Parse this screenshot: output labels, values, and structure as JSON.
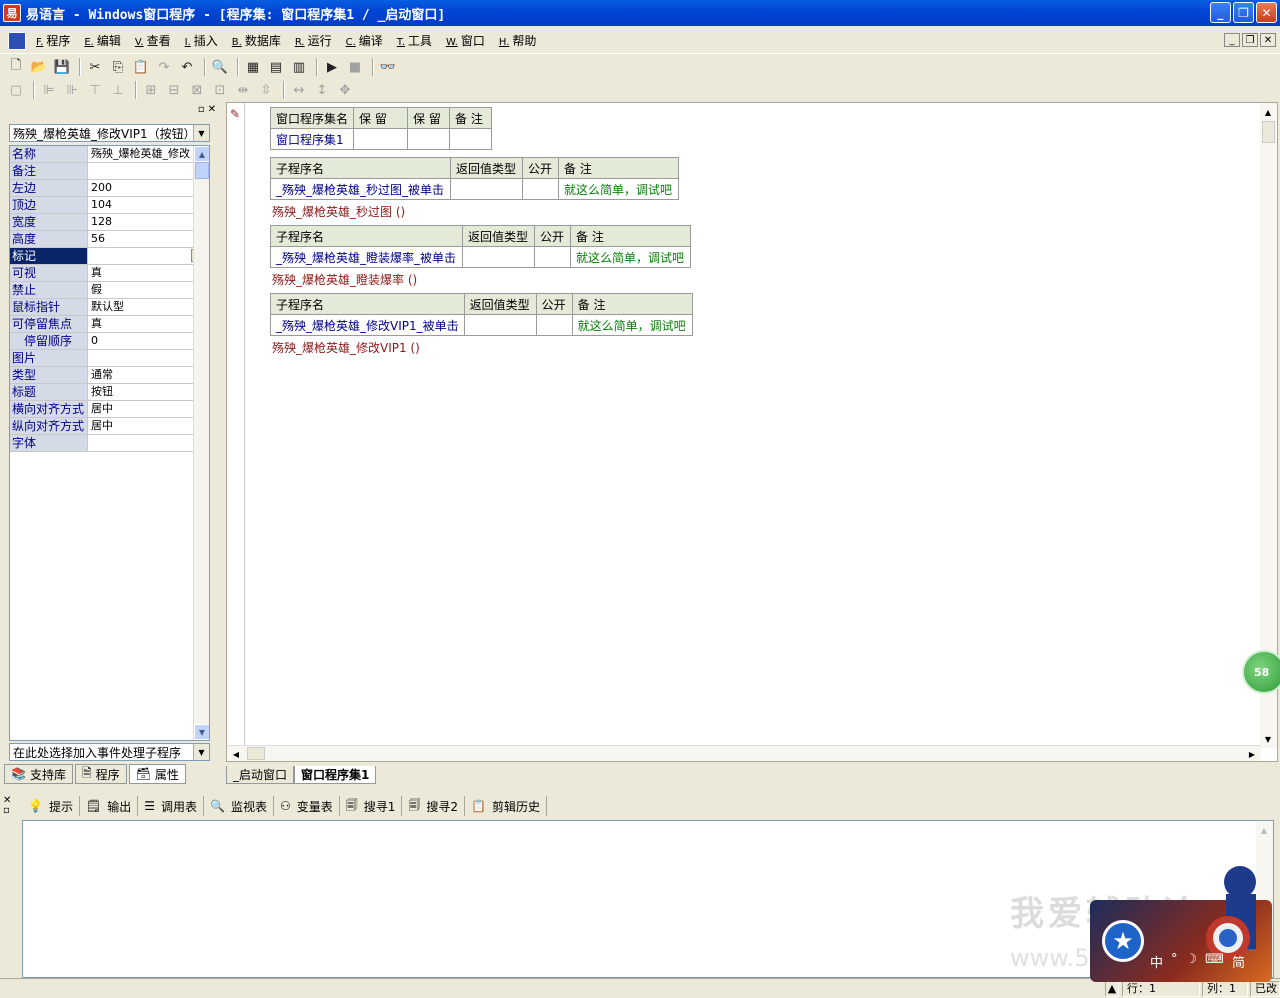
{
  "window": {
    "title": "易语言 - Windows窗口程序 - [程序集: 窗口程序集1 / _启动窗口]"
  },
  "menu": [
    {
      "acc": "F.",
      "label": "程序"
    },
    {
      "acc": "E.",
      "label": "编辑"
    },
    {
      "acc": "V.",
      "label": "查看"
    },
    {
      "acc": "I.",
      "label": "插入"
    },
    {
      "acc": "B.",
      "label": "数据库"
    },
    {
      "acc": "R.",
      "label": "运行"
    },
    {
      "acc": "C.",
      "label": "编译"
    },
    {
      "acc": "T.",
      "label": "工具"
    },
    {
      "acc": "W.",
      "label": "窗口"
    },
    {
      "acc": "H.",
      "label": "帮助"
    }
  ],
  "left_panel": {
    "object_combo": "殇殃_爆枪英雄_修改VIP1（按钮）",
    "properties": [
      {
        "name": "名称",
        "value": "殇殃_爆枪英雄_修改"
      },
      {
        "name": "备注",
        "value": ""
      },
      {
        "name": "左边",
        "value": "200"
      },
      {
        "name": "顶边",
        "value": "104"
      },
      {
        "name": "宽度",
        "value": "128"
      },
      {
        "name": "高度",
        "value": "56"
      },
      {
        "name": "标记",
        "value": "",
        "selected": true
      },
      {
        "name": "可视",
        "value": "真"
      },
      {
        "name": "禁止",
        "value": "假"
      },
      {
        "name": "鼠标指针",
        "value": "默认型"
      },
      {
        "name": "可停留焦点",
        "value": "真"
      },
      {
        "name": "停留顺序",
        "value": "0",
        "indent": true
      },
      {
        "name": "图片",
        "value": ""
      },
      {
        "name": "类型",
        "value": "通常"
      },
      {
        "name": "标题",
        "value": "按钮"
      },
      {
        "name": "横向对齐方式",
        "value": "居中"
      },
      {
        "name": "纵向对齐方式",
        "value": "居中"
      },
      {
        "name": "字体",
        "value": ""
      }
    ],
    "event_combo": "在此处选择加入事件处理子程序",
    "tabs": [
      "支持库",
      "程序",
      "属性"
    ]
  },
  "editor": {
    "assembly_table": {
      "headers": [
        "窗口程序集名",
        "保 留",
        "保 留",
        "备 注"
      ],
      "row": [
        "窗口程序集1",
        "",
        "",
        ""
      ]
    },
    "sub_headers": [
      "子程序名",
      "返回值类型",
      "公开",
      "备 注"
    ],
    "subs": [
      {
        "name": "_殇殃_爆枪英雄_秒过图_被单击",
        "ret": "",
        "pub": "",
        "note": "就这么简单，调试吧",
        "call": "殇殃_爆枪英雄_秒过图 ()"
      },
      {
        "name": "_殇殃_爆枪英雄_瞪装爆率_被单击",
        "ret": "",
        "pub": "",
        "note": "就这么简单，调试吧",
        "call": "殇殃_爆枪英雄_瞪装爆率 ()"
      },
      {
        "name": "_殇殃_爆枪英雄_修改VIP1_被单击",
        "ret": "",
        "pub": "",
        "note": "就这么简单，调试吧",
        "call": "殇殃_爆枪英雄_修改VIP1 ()"
      }
    ]
  },
  "doc_tabs": [
    "_启动窗口",
    "窗口程序集1"
  ],
  "bottom_tabs": [
    {
      "icon": "hint-icon",
      "label": "提示"
    },
    {
      "icon": "output-icon",
      "label": "输出"
    },
    {
      "icon": "call-table-icon",
      "label": "调用表"
    },
    {
      "icon": "monitor-icon",
      "label": "监视表"
    },
    {
      "icon": "variable-icon",
      "label": "变量表"
    },
    {
      "icon": "search-icon",
      "label": "搜寻1"
    },
    {
      "icon": "search-icon",
      "label": "搜寻2"
    },
    {
      "icon": "clipboard-icon",
      "label": "剪辑历史"
    }
  ],
  "status": {
    "row": "行：1",
    "col": "列：1",
    "mode": "已改"
  },
  "badge": "58",
  "watermark": {
    "line1": "我爱辅助论",
    "line2": "www.52"
  },
  "ime": {
    "chars": [
      "中",
      "°",
      "☽",
      "⌨",
      "简"
    ]
  }
}
